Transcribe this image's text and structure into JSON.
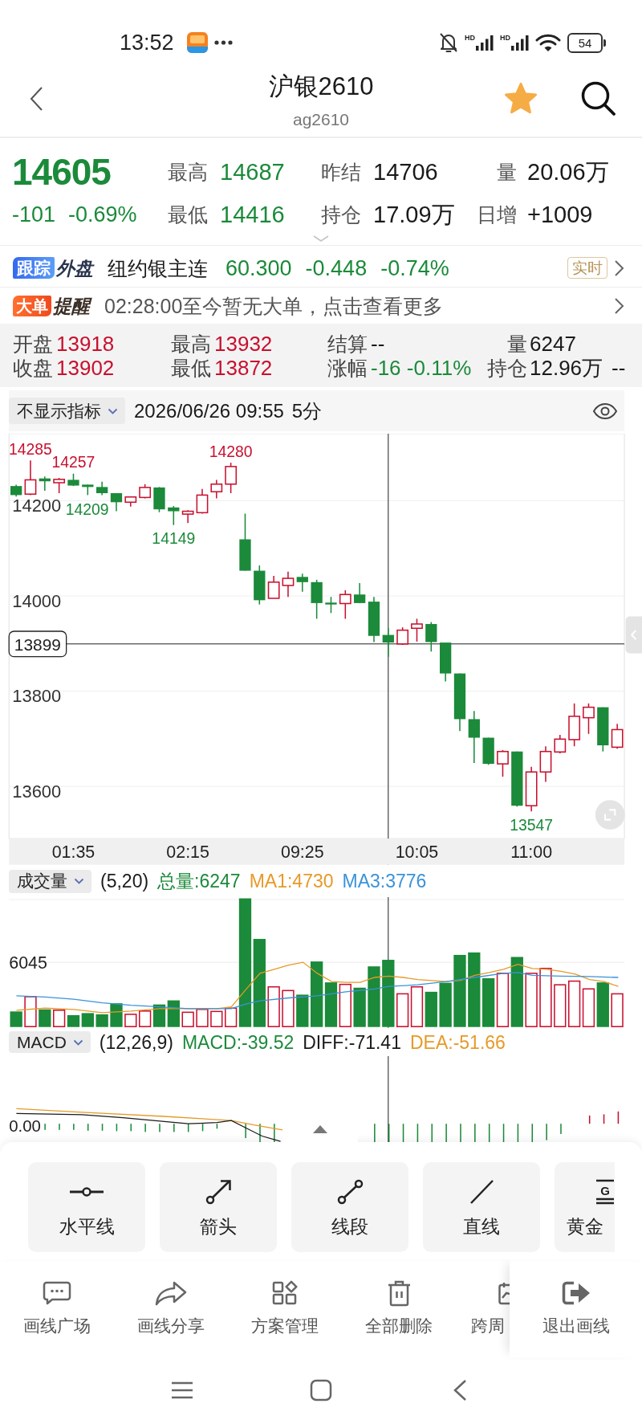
{
  "status_bar": {
    "time": "13:52",
    "network_labels": [
      "HD",
      "HD"
    ],
    "battery": "54"
  },
  "header": {
    "title": "沪银2610",
    "subtitle": "ag2610",
    "favorite": true
  },
  "quote": {
    "price": "14605",
    "change": "-101",
    "change_pct": "-0.69%",
    "color": "#1b8a3a",
    "stats": [
      {
        "label": "最高",
        "value": "14687",
        "color": "#1b8a3a"
      },
      {
        "label": "昨结",
        "value": "14706",
        "color": "#1a1a1a"
      },
      {
        "label": "量",
        "value": "20.06万",
        "color": "#1a1a1a"
      },
      {
        "label": "最低",
        "value": "14416",
        "color": "#1b8a3a"
      },
      {
        "label": "持仓",
        "value": "17.09万",
        "color": "#1a1a1a"
      },
      {
        "label": "日增",
        "value": "+1009",
        "color": "#1a1a1a"
      }
    ]
  },
  "foreign_market": {
    "badge": "跟踪",
    "badge_suffix": "外盘",
    "name": "纽约银主连",
    "price": "60.300",
    "change": "-0.448",
    "change_pct": "-0.74%",
    "color": "#1b8a3a",
    "tag": "实时"
  },
  "block_alert": {
    "badge": "大单",
    "badge_suffix": "提醒",
    "message": "02:28:00至今暂无大单，点击查看更多"
  },
  "bar_info": {
    "rows": [
      {
        "items": [
          {
            "label": "开盘",
            "value": "13918",
            "color": "#c8102e"
          },
          {
            "label": "最高",
            "value": "13932",
            "color": "#c8102e"
          },
          {
            "label": "结算",
            "value": "--",
            "color": "#1a1a1a"
          },
          {
            "label": "量",
            "value": "6247",
            "color": "#1a1a1a"
          }
        ]
      },
      {
        "items": [
          {
            "label": "收盘",
            "value": "13902",
            "color": "#c8102e"
          },
          {
            "label": "最低",
            "value": "13872",
            "color": "#c8102e"
          },
          {
            "label": "涨幅",
            "value": "-16 -0.11%",
            "color": "#1b8a3a"
          },
          {
            "label": "持仓",
            "value": "12.96万",
            "color": "#1a1a1a"
          },
          {
            "value": "--",
            "color": "#1a1a1a"
          }
        ]
      }
    ]
  },
  "indicator_bar": {
    "selector": "不显示指标",
    "datetime": "2026/06/26 09:55",
    "period": "5分"
  },
  "price_chart": {
    "chart_data": {
      "type": "candlestick",
      "categories": [
        null,
        null,
        null,
        null,
        "01:35",
        null,
        null,
        null,
        null,
        null,
        null,
        null,
        "02:15",
        null,
        null,
        null,
        null,
        null,
        null,
        null,
        "09:25",
        null,
        null,
        null,
        null,
        null,
        null,
        null,
        "10:05",
        null,
        null,
        null,
        null,
        null,
        null,
        null,
        "11:00",
        null,
        null,
        null,
        null,
        null,
        null
      ],
      "ohlc": [
        [
          14231,
          14234,
          14209,
          14212
        ],
        [
          14214,
          14285,
          14212,
          14244
        ],
        [
          14247,
          14251,
          14221,
          14241
        ],
        [
          14238,
          14248,
          14216,
          14245
        ],
        [
          14244,
          14257,
          14231,
          14232
        ],
        [
          14234,
          14234,
          14212,
          14229
        ],
        [
          14229,
          14240,
          14212,
          14216
        ],
        [
          14216,
          14216,
          14178,
          14197
        ],
        [
          14197,
          14208,
          14188,
          14208
        ],
        [
          14207,
          14235,
          14205,
          14228
        ],
        [
          14228,
          14229,
          14176,
          14182
        ],
        [
          14186,
          14189,
          14149,
          14178
        ],
        [
          14172,
          14180,
          14153,
          14178
        ],
        [
          14175,
          14225,
          14173,
          14212
        ],
        [
          14219,
          14244,
          14205,
          14235
        ],
        [
          14235,
          14280,
          14216,
          14272
        ],
        [
          14119,
          14173,
          14053,
          14053
        ],
        [
          14053,
          14064,
          13982,
          13991
        ],
        [
          13995,
          14042,
          13995,
          14029
        ],
        [
          14022,
          14051,
          13998,
          14037
        ],
        [
          14040,
          14047,
          14009,
          14029
        ],
        [
          14029,
          14034,
          13952,
          13985
        ],
        [
          13986,
          13998,
          13964,
          13982
        ],
        [
          13984,
          14012,
          13952,
          14003
        ],
        [
          14003,
          14027,
          13985,
          13985
        ],
        [
          13988,
          13998,
          13903,
          13916
        ],
        [
          13918,
          13932,
          13872,
          13902
        ],
        [
          13899,
          13934,
          13897,
          13928
        ],
        [
          13932,
          13952,
          13904,
          13941
        ],
        [
          13941,
          13945,
          13883,
          13903
        ],
        [
          13902,
          13902,
          13820,
          13837
        ],
        [
          13837,
          13837,
          13716,
          13741
        ],
        [
          13741,
          13758,
          13649,
          13702
        ],
        [
          13702,
          13702,
          13645,
          13647
        ],
        [
          13647,
          13676,
          13620,
          13673
        ],
        [
          13673,
          13673,
          13557,
          13559
        ],
        [
          13559,
          13641,
          13547,
          13630
        ],
        [
          13630,
          13684,
          13609,
          13673
        ],
        [
          13672,
          13708,
          13669,
          13699
        ],
        [
          13698,
          13774,
          13684,
          13747
        ],
        [
          13744,
          13774,
          13710,
          13766
        ],
        [
          13766,
          13766,
          13673,
          13686
        ],
        [
          13682,
          13731,
          13679,
          13719
        ]
      ],
      "ylim": [
        13490,
        14341
      ],
      "yticks": [
        14200,
        14000,
        13800,
        13600
      ],
      "grid": true,
      "annotations": [
        {
          "y": 14285,
          "text": "14285"
        },
        {
          "y": 14257,
          "text": "14257"
        },
        {
          "y": 14280,
          "text": "14280"
        },
        "14209",
        {
          "y": 14149,
          "text": "14149"
        },
        {
          "y": 13547,
          "text": "13547"
        }
      ],
      "ref_lines": [
        {
          "axis": "y",
          "value": 13899,
          "label": "13899"
        }
      ]
    }
  },
  "volume_panel": {
    "selector": "成交量",
    "params": "(5,20)",
    "readings": [
      {
        "text": "总量:6247",
        "color": "#1b8a3a"
      },
      {
        "text": "MA1:4730",
        "color": "#e69a28"
      },
      {
        "text": "MA3:3776",
        "color": "#3a93d8"
      }
    ],
    "tick": "6045"
  },
  "macd_panel": {
    "selector": "MACD",
    "params": "(12,26,9)",
    "readings": [
      {
        "text": "MACD:-39.52",
        "color": "#1b8a3a"
      },
      {
        "text": "DIFF:-71.41",
        "color": "#1a1a1a"
      },
      {
        "text": "DEA:-51.66",
        "color": "#e69a28"
      }
    ],
    "tick": "0.00"
  },
  "drawing_tools": [
    {
      "label": "水平线",
      "partial": false
    },
    {
      "label": "箭头",
      "partial": false
    },
    {
      "label": "线段",
      "partial": false
    },
    {
      "label": "直线",
      "partial": false
    },
    {
      "label": "黄金",
      "partial": true,
      "icon_text": "G"
    }
  ],
  "actions": [
    {
      "label": "画线广场",
      "partial": false
    },
    {
      "label": "画线分享",
      "partial": false
    },
    {
      "label": "方案管理",
      "partial": false
    },
    {
      "label": "全部删除",
      "partial": false
    },
    {
      "label": "跨周",
      "partial": true
    }
  ],
  "exit_button": {
    "label": "退出画线"
  }
}
